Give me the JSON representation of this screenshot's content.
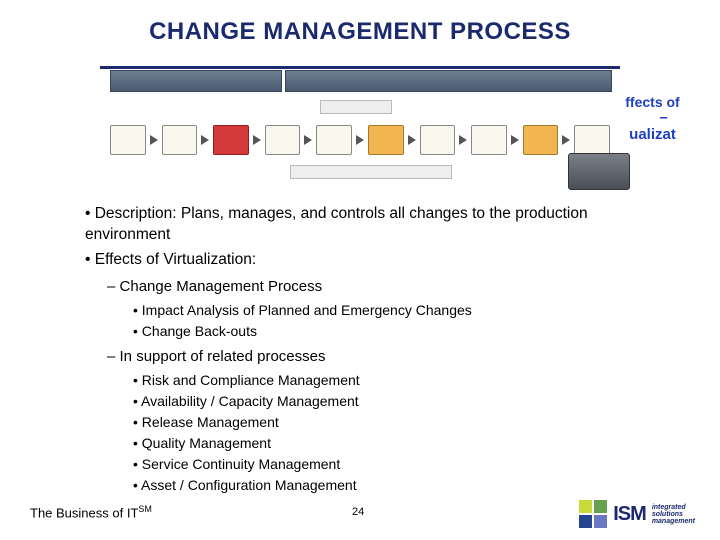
{
  "title": "CHANGE MANAGEMENT PROCESS",
  "virt_tag": {
    "l1": "ffects of",
    "l2": "ualizat"
  },
  "body": {
    "b1": "Description: Plans, manages, and controls all changes to the production environment",
    "b2": "Effects of Virtualization:",
    "b2_1": "Change Management Process",
    "b2_1_items": [
      "Impact Analysis of Planned and Emergency Changes",
      "Change Back-outs"
    ],
    "b2_2": "In support of related processes",
    "b2_2_items": [
      "Risk and Compliance Management",
      "Availability / Capacity Management",
      "Release Management",
      "Quality Management",
      "Service Continuity Management",
      "Asset / Configuration Management"
    ]
  },
  "footer": {
    "tagline": "The Business of IT",
    "tm": "SM"
  },
  "page_number": "24",
  "logo": {
    "acronym": "ISM",
    "full": [
      "integrated",
      "solutions",
      "management"
    ],
    "colors": {
      "tl": "#c8da3a",
      "tr": "#66a14f",
      "bl": "#27448f",
      "br": "#6a78c3"
    }
  }
}
